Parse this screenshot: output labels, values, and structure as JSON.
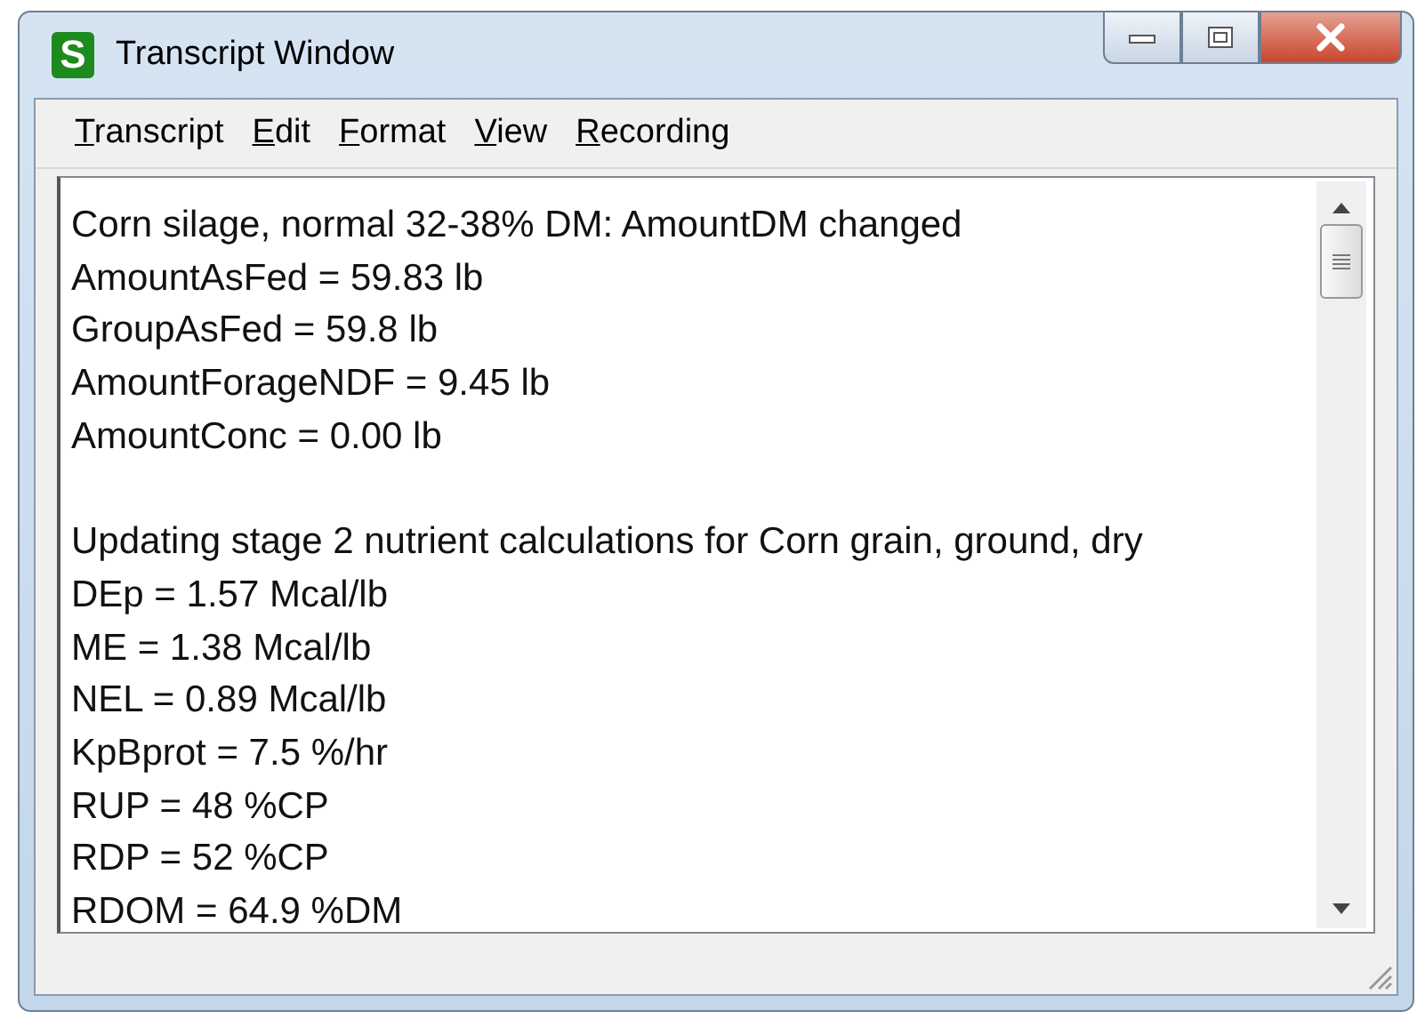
{
  "window": {
    "title": "Transcript Window",
    "logo_letter": "S"
  },
  "menu": [
    {
      "label": "Transcript"
    },
    {
      "label": "Edit"
    },
    {
      "label": "Format"
    },
    {
      "label": "View"
    },
    {
      "label": "Recording"
    }
  ],
  "transcript_blocks": [
    [
      "Corn silage, normal 32-38% DM: AmountDM changed",
      "AmountAsFed = 59.83 lb",
      "GroupAsFed = 59.8 lb",
      "AmountForageNDF = 9.45 lb",
      "AmountConc = 0.00 lb"
    ],
    [
      "Updating stage 2 nutrient calculations for Corn grain, ground, dry",
      "DEp = 1.57 Mcal/lb",
      "ME = 1.38 Mcal/lb",
      "NEL = 0.89 Mcal/lb",
      "KpBprot = 7.5 %/hr",
      "RUP = 48 %CP",
      "RDP = 52 %CP",
      "RDOM = 64.9 %DM"
    ]
  ]
}
